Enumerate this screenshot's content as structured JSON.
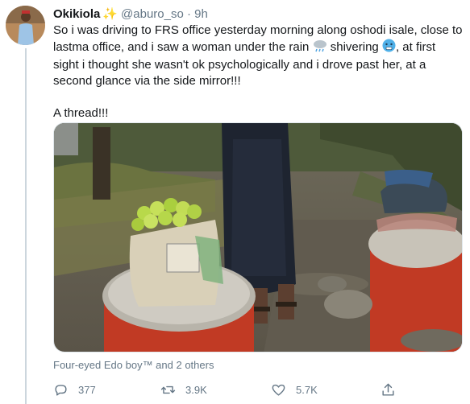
{
  "tweet": {
    "display_name": "Okikiola",
    "name_emoji": "sparkles-icon",
    "handle": "@aburo_so",
    "separator": "·",
    "timestamp": "9h",
    "text_before_rain": "So i was driving to FRS office yesterday morning along oshodi isale, close to lastma office, and i saw a woman under the rain",
    "text_before_shiver": "shivering",
    "text_after": ", at first sight i thought she wasn't ok psychologically and i drove past her, at a second glance via the side mirror!!!",
    "thread_label": "A thread!!!"
  },
  "media": {
    "icon": "street-oranges-photo"
  },
  "social": {
    "liked_by": "Four-eyed Edo boy™ and 2 others"
  },
  "actions": {
    "reply_count": "377",
    "retweet_count": "3.9K",
    "like_count": "5.7K"
  },
  "colors": {
    "text": "#14171a",
    "muted": "#657786",
    "thread_line": "#ccd6dd",
    "sparkle": "#f4b400"
  }
}
